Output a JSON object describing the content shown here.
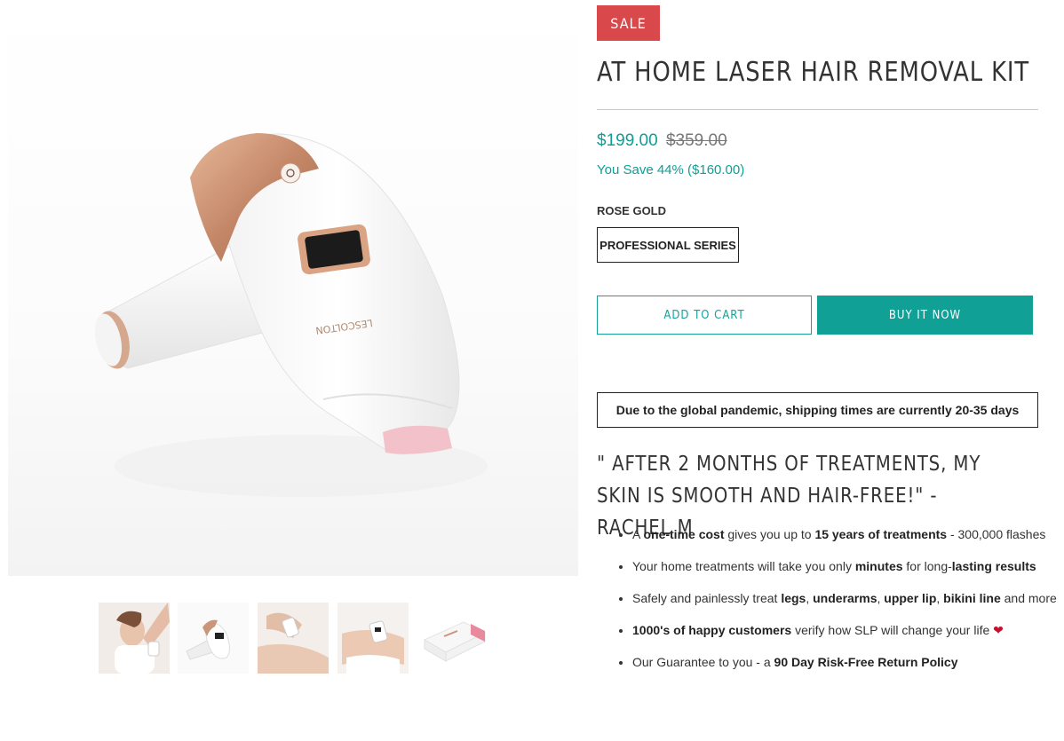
{
  "gallery": {
    "main_image_alt": "LESCOLTON laser hair removal handset",
    "device_brand_text": "LESCOLTON",
    "thumbnails": [
      {
        "name": "thumb-woman-underarm"
      },
      {
        "name": "thumb-device-product"
      },
      {
        "name": "thumb-legs-treatment"
      },
      {
        "name": "thumb-bikini-treatment"
      },
      {
        "name": "thumb-box-packaging"
      }
    ]
  },
  "product": {
    "badge": "SALE",
    "title": "AT HOME LASER HAIR REMOVAL KIT",
    "price_current": "$199.00",
    "price_original": "$359.00",
    "savings": "You Save 44% ($160.00)",
    "variant_label": "ROSE GOLD",
    "variant_option": "PROFESSIONAL SERIES",
    "add_to_cart": "ADD TO CART",
    "buy_now": "BUY IT NOW",
    "notice": "Due to the global pandemic, shipping times are currently 20-35 days",
    "quote": "\" AFTER 2 MONTHS OF TREATMENTS, MY SKIN IS SMOOTH AND HAIR-FREE!\" -RACHEL M"
  },
  "bullets": [
    {
      "a": "A ",
      "b": "one-time cost",
      "c": " gives you up to ",
      "d": "15 years of treatments",
      "e": " - 300,000 flashes"
    },
    {
      "a": "Your home treatments will take you only ",
      "b": "minutes",
      "c": " for long-",
      "d": "lasting results"
    },
    {
      "a": "Safely and painlessly treat ",
      "b": "legs",
      "c": ", ",
      "d": "underarms",
      "e": ", ",
      "f": "upper lip",
      "g": ", ",
      "h": "bikini line",
      "i": " and more"
    },
    {
      "a": "1000's of happy customers",
      "b": " verify how SLP will change your life ",
      "heart": "❤"
    },
    {
      "a": "Our Guarantee to you - a ",
      "b": "90 Day Risk-Free Return Policy"
    }
  ],
  "colors": {
    "sale_badge": "#d9484a",
    "accent_teal": "#10a096",
    "rose_gold": "#c9967a"
  }
}
